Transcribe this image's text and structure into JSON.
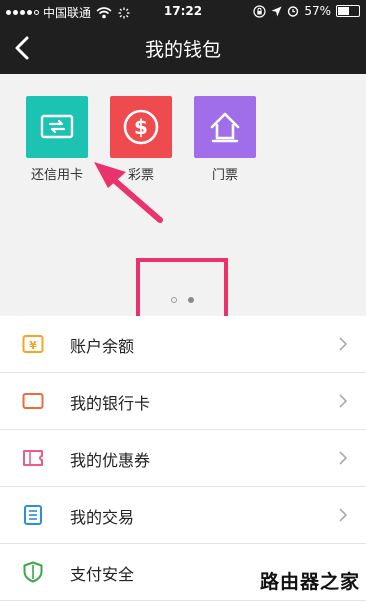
{
  "status_bar": {
    "carrier": "中国联通",
    "time": "17:22",
    "battery_percent": "57%",
    "battery_level": 0.57,
    "icons": [
      "signal-dots-icon",
      "wifi-icon",
      "loading-icon",
      "lock-rotation-icon",
      "location-icon",
      "alarm-icon",
      "battery-icon"
    ]
  },
  "nav": {
    "title": "我的钱包",
    "back_icon": "chevron-left-icon"
  },
  "apps": [
    {
      "label": "还信用卡",
      "icon": "card-repay-icon",
      "color": "#1cc3b3"
    },
    {
      "label": "彩票",
      "icon": "dollar-coin-icon",
      "color": "#ef4b4f"
    },
    {
      "label": "门票",
      "icon": "house-ticket-icon",
      "color": "#9f6ee8"
    }
  ],
  "pager": {
    "pages": 2,
    "current": 2
  },
  "list": [
    {
      "label": "账户余额",
      "icon": "balance-icon",
      "color": "#f5a623"
    },
    {
      "label": "我的银行卡",
      "icon": "bank-card-icon",
      "color": "#f06a3a"
    },
    {
      "label": "我的优惠券",
      "icon": "coupon-icon",
      "color": "#ec5d86"
    },
    {
      "label": "我的交易",
      "icon": "transaction-list-icon",
      "color": "#2a90d8"
    },
    {
      "label": "支付安全",
      "icon": "shield-icon",
      "color": "#3aa74a"
    }
  ],
  "annotation_color": "#e8336d",
  "watermark": "路由器之家"
}
